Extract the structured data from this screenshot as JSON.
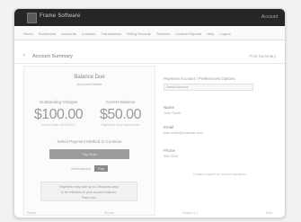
{
  "app": {
    "title": "Frame Software",
    "top_right": "Account"
  },
  "nav": {
    "items": [
      "Home",
      "Dashboard",
      "Accounts",
      "Contacts",
      "Transactions",
      "Billing Records",
      "Services",
      "Custom Reports",
      "Help",
      "Logout"
    ]
  },
  "breadcrumb": {
    "back": "‹",
    "title": "Account Summary",
    "action": "Print Summary"
  },
  "summary": {
    "title": "Balance Due",
    "subtitle": "Account Details",
    "outstanding": {
      "label": "Outstanding Charges",
      "value": "$100.00",
      "note": "Invoice date 10/12/2014"
    },
    "current": {
      "label": "Current Balance",
      "value": "$50.00",
      "note": "Payments since last invoice"
    },
    "method_label": "Select Payment Method to Continue",
    "pay_button": "Pay Now",
    "alt_label": "Alternatively",
    "alt_badge": "Pay",
    "notice_line1": "Payments may take up to 2 business days",
    "notice_line2": "to be reflected on your account balance.",
    "notice_line3": "Thank you."
  },
  "details": {
    "header": "Payment Account / Preferences Options",
    "select_value": "Default Account",
    "groups": [
      {
        "label": "Name",
        "value": "John Smith"
      },
      {
        "label": "Email",
        "value": "john.smith@example.com"
      },
      {
        "label": "Phone",
        "value": "555-0100"
      }
    ],
    "footer": "Contact support for account questions"
  },
  "status": {
    "items": [
      "Ready",
      "Secure",
      "Version 2.1",
      "Help"
    ]
  }
}
